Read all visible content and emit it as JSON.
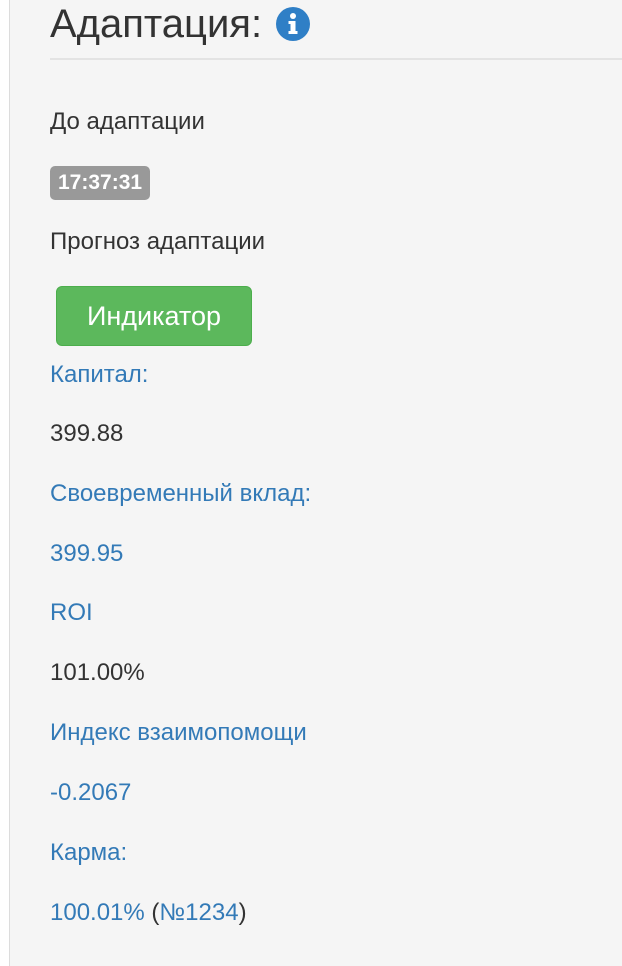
{
  "header": {
    "title": "Адаптация:",
    "info_icon_color": "#2f7fc6"
  },
  "before": {
    "label": "До адаптации",
    "time": "17:37:31"
  },
  "forecast": {
    "label": "Прогноз адаптации",
    "button_label": "Индикатор",
    "button_color": "#5cb85c"
  },
  "stats": {
    "capital_label": "Капитал:",
    "capital_value": "399.88",
    "timely_deposit_label": "Своевременный вклад:",
    "timely_deposit_value": "399.95",
    "roi_label": "ROI",
    "roi_value": "101.00%",
    "mutual_aid_label": "Индекс взаимопомощи",
    "mutual_aid_value": "-0.2067",
    "karma_label": "Карма:",
    "karma_value": "100.01%",
    "karma_rank": "№1234"
  },
  "colors": {
    "link": "#337ab7",
    "text": "#333333",
    "badge": "#999999",
    "panel_bg": "#f5f5f5"
  }
}
